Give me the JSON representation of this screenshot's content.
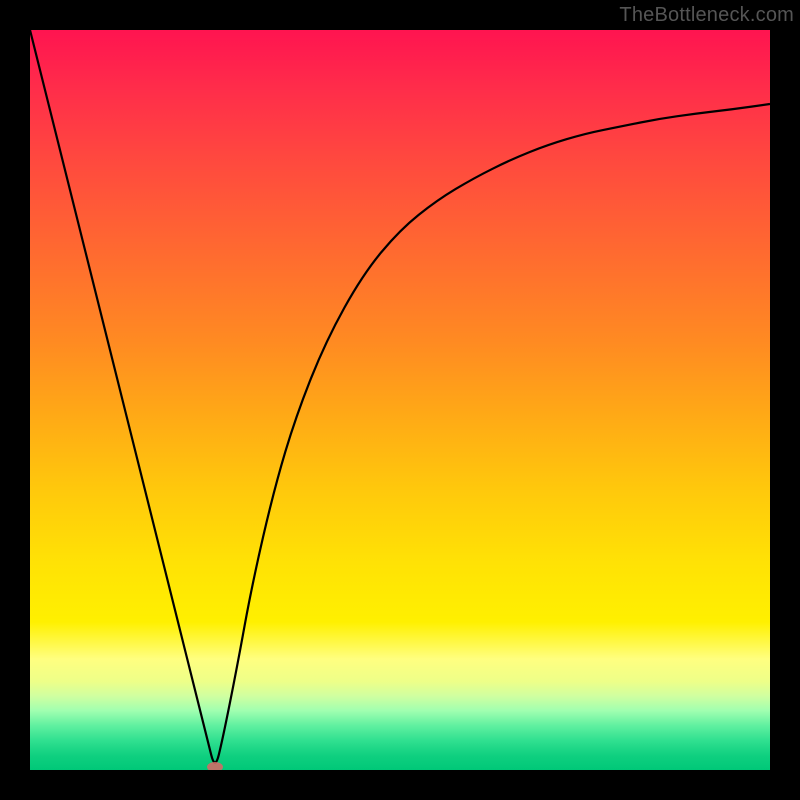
{
  "watermark": "TheBottleneck.com",
  "chart_data": {
    "type": "line",
    "title": "",
    "xlabel": "",
    "ylabel": "",
    "xlim": [
      0,
      100
    ],
    "ylim": [
      0,
      100
    ],
    "grid": false,
    "legend": false,
    "series": [
      {
        "name": "curve",
        "x": [
          0,
          5,
          10,
          15,
          20,
          22,
          24,
          25,
          26,
          28,
          30,
          33,
          36,
          40,
          45,
          50,
          55,
          60,
          65,
          70,
          75,
          80,
          85,
          90,
          95,
          100
        ],
        "y": [
          100,
          80,
          60,
          40,
          20,
          12,
          4,
          0,
          4,
          14,
          25,
          38,
          48,
          58,
          67,
          73,
          77,
          80,
          82.5,
          84.5,
          86,
          87,
          88,
          88.7,
          89.3,
          90
        ]
      }
    ],
    "marker": {
      "x": 25,
      "y": 0,
      "color": "#d66",
      "radius": 7
    },
    "background_gradient": {
      "top": "#ff1450",
      "mid": "#ffc800",
      "bottom": "#00c878"
    }
  }
}
